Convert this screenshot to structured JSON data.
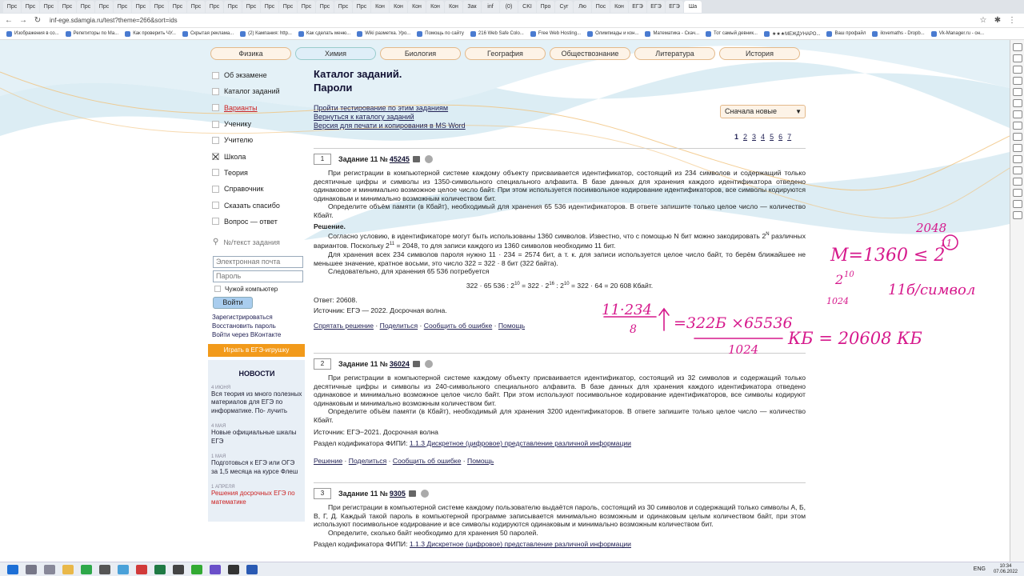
{
  "browser": {
    "tabs": [
      "Прс",
      "Прс",
      "Прс",
      "Прс",
      "Прс",
      "Прс",
      "Прс",
      "Прс",
      "Прс",
      "Прс",
      "Прс",
      "Прс",
      "Прс",
      "Прс",
      "Прс",
      "Прс",
      "Прс",
      "Прс",
      "Прс",
      "Прс",
      "Кон",
      "Кон",
      "Кон",
      "Кон",
      "Кон",
      "Зак",
      "inf",
      "(0)",
      "CKI",
      "Про",
      "Суг",
      "Лю",
      "Пос",
      "Кон",
      "ЕГЭ",
      "ЕГЭ",
      "ЕГЭ",
      "Ша"
    ],
    "active_tab": 37,
    "url": "inf-ege.sdamgia.ru/test?theme=266&sort=ids",
    "bookmarks": [
      "Изображения в со...",
      "Репетиторы по Ма...",
      "Как проверить ЧУ...",
      "Скрытая реклама...",
      "(2) Кампания: http...",
      "Как сделать меню...",
      "Wiki разметка. Уро...",
      "Помощь по сайту",
      "216 Web Safe Colo...",
      "Free Web Hosting...",
      "Олимпиады и кон...",
      "Математика - Скач...",
      "Тот самый девник...",
      "★★★МЕЖДУНАРО...",
      "Ваш профайл",
      "ilovemaths - Dropb...",
      "Vk-Manager.ru - он..."
    ]
  },
  "subjects": [
    "Физика",
    "Химия",
    "Биология",
    "География",
    "Обществознание",
    "Литература",
    "История"
  ],
  "sidebar": {
    "items": [
      {
        "label": "Об экзамене",
        "checked": false,
        "red": false
      },
      {
        "label": "Каталог заданий",
        "checked": false,
        "red": false
      },
      {
        "label": "Варианты",
        "checked": false,
        "red": true
      },
      {
        "label": "Ученику",
        "checked": false,
        "red": false
      },
      {
        "label": "Учителю",
        "checked": false,
        "red": false
      },
      {
        "label": "Школа",
        "checked": true,
        "red": false
      },
      {
        "label": "Теория",
        "checked": false,
        "red": false
      },
      {
        "label": "Справочник",
        "checked": false,
        "red": false
      },
      {
        "label": "Сказать спасибо",
        "checked": false,
        "red": false
      },
      {
        "label": "Вопрос — ответ",
        "checked": false,
        "red": false
      }
    ],
    "search_placeholder": "№/текст задания",
    "email_placeholder": "Электронная почта",
    "password_placeholder": "Пароль",
    "alien_computer": "Чужой компьютер",
    "login_button": "Войти",
    "register": "Зарегистрироваться",
    "restore": "Восстановить пароль",
    "vk": "Войти через ВКонтакте",
    "game_button": "Играть в ЕГЭ-игрушку",
    "news_title": "НОВОСТИ",
    "news": [
      {
        "date": "4 июня",
        "text": "Вся теория из много полезных материалов для ЕГЭ по информатике. По- лучить",
        "red": false
      },
      {
        "date": "4 мая",
        "text": "Новые официальные шкалы ЕГЭ",
        "red": false
      },
      {
        "date": "1 мая",
        "text": "Подготовься к ЕГЭ или ОГЭ за 1,5 месяца на курсе Флеш",
        "red": false
      },
      {
        "date": "1 апреля",
        "text": "Решения досрочных ЕГЭ по математике",
        "red": true
      }
    ]
  },
  "content": {
    "title_line1": "Каталог заданий.",
    "title_line2": "Пароли",
    "links": [
      "Пройти тестирование по этим заданиям",
      "Вернуться к каталогу заданий",
      "Версия для печати и копирования в MS Word"
    ],
    "sort_label": "Сначала новые",
    "pages": [
      "1",
      "2",
      "3",
      "4",
      "5",
      "6",
      "7"
    ],
    "current_page": "1",
    "task_label": "Задание 11 №",
    "tasks": [
      {
        "num": "1",
        "id": "45245",
        "text": "При регистрации в компьютерной системе каждому объекту присваивается идентификатор, состоящий из 234 символов и содержащий только десятичные цифры и символы из 1350-символьного специального алфавита. В базе данных для хранения каждого идентификатора отведено одинаковое и минимально возможное целое число байт. При этом используется посимвольное кодирование идентификаторов, все символы кодируются одинаковым и минимально возможным количеством бит.",
        "question": "Определите объём памяти (в Кбайт), необходимый для хранения 65 536 идентификаторов. В ответе запишите только целое число — количество Кбайт.",
        "solution_title": "Решение.",
        "solution1": "Согласно условию, в идентификаторе могут быть использованы 1360 символов. Известно, что с помощью N бит можно закодировать 2^N различных вариантов. Поскольку 2^11 = 2048, то для записи каждого из 1360 символов необходимо 11 бит.",
        "solution2": "Для хранения всех 234 символов пароля нужно 11 · 234 = 2574 бит, а т. к. для записи используется целое число байт, то берём ближайшее не меньшее значение, кратное восьми, это число 322 = 322 · 8 бит (322 байта).",
        "solution3": "Следовательно, для хранения 65 536 потребуется",
        "formula": "322 · 65 536 : 2^10 = 322 · 2^16 : 2^10 = 322 · 64 = 20 608 Кбайт.",
        "answer": "Ответ: 20608.",
        "source": "Источник: ЕГЭ — 2022. Досрочная волна.",
        "actions": [
          "Спрятать решение",
          "Поделиться",
          "Сообщить об ошибке",
          "Помощь"
        ]
      },
      {
        "num": "2",
        "id": "36024",
        "text": "При регистрации в компьютерной системе каждому объекту присваивается идентификатор, состоящий из 32 символов и содержащий только десятичные цифры и символы из 240-символьного специального алфавита. В базе данных для хранения каждого идентификатора отведено одинаковое и минимально возможное целое число байт. При этом используют посимвольное кодирование идентификаторов, все символы кодируют одинаковым и минимально возможным количеством бит.",
        "question": "Определите объём памяти (в Кбайт), необходимый для хранения 3200 идентификаторов. В ответе запишите только целое число — количество Кбайт.",
        "source": "Источник: ЕГЭ−2021. Досрочная волна",
        "codifier_label": "Раздел кодификатора ФИПИ:",
        "codifier": "1.1.3 Дискретное (цифровое) представление различной информации",
        "actions": [
          "Решение",
          "Поделиться",
          "Сообщить об ошибке",
          "Помощь"
        ]
      },
      {
        "num": "3",
        "id": "9305",
        "text": "При регистрации в компьютерной системе каждому пользователю выдаётся пароль, состоящий из 30 символов и содержащий только символы А, Б, В, Г, Д. Каждый такой пароль в компьютерной программе записывается минимально возможным и одинаковым целым количеством байт, при этом используют посимвольное кодирование и все символы кодируются одинаковым и минимально возможным количеством бит.",
        "question": "Определите, сколько байт необходимо для хранения 50 паролей.",
        "codifier_label": "Раздел кодификатора ФИПИ:",
        "codifier": "1.1.3 Дискретное (цифровое) представление различной информации"
      }
    ]
  },
  "handwriting": {
    "line1": "M=1360 ≤ 2",
    "exp": "11",
    "over": "2048",
    "pow": "2",
    "pow_exp": "10",
    "note_1024": "1024",
    "bits": "11б/символ",
    "frac_num": "11·234",
    "frac_den": "8",
    "mult": "=322Б ×65536",
    "den2": "1024",
    "result": "КБ = 20608 КБ",
    "color": "#d6198c"
  },
  "taskbar": {
    "lang": "ENG",
    "time": "10:34",
    "date": "07.06.2022"
  }
}
